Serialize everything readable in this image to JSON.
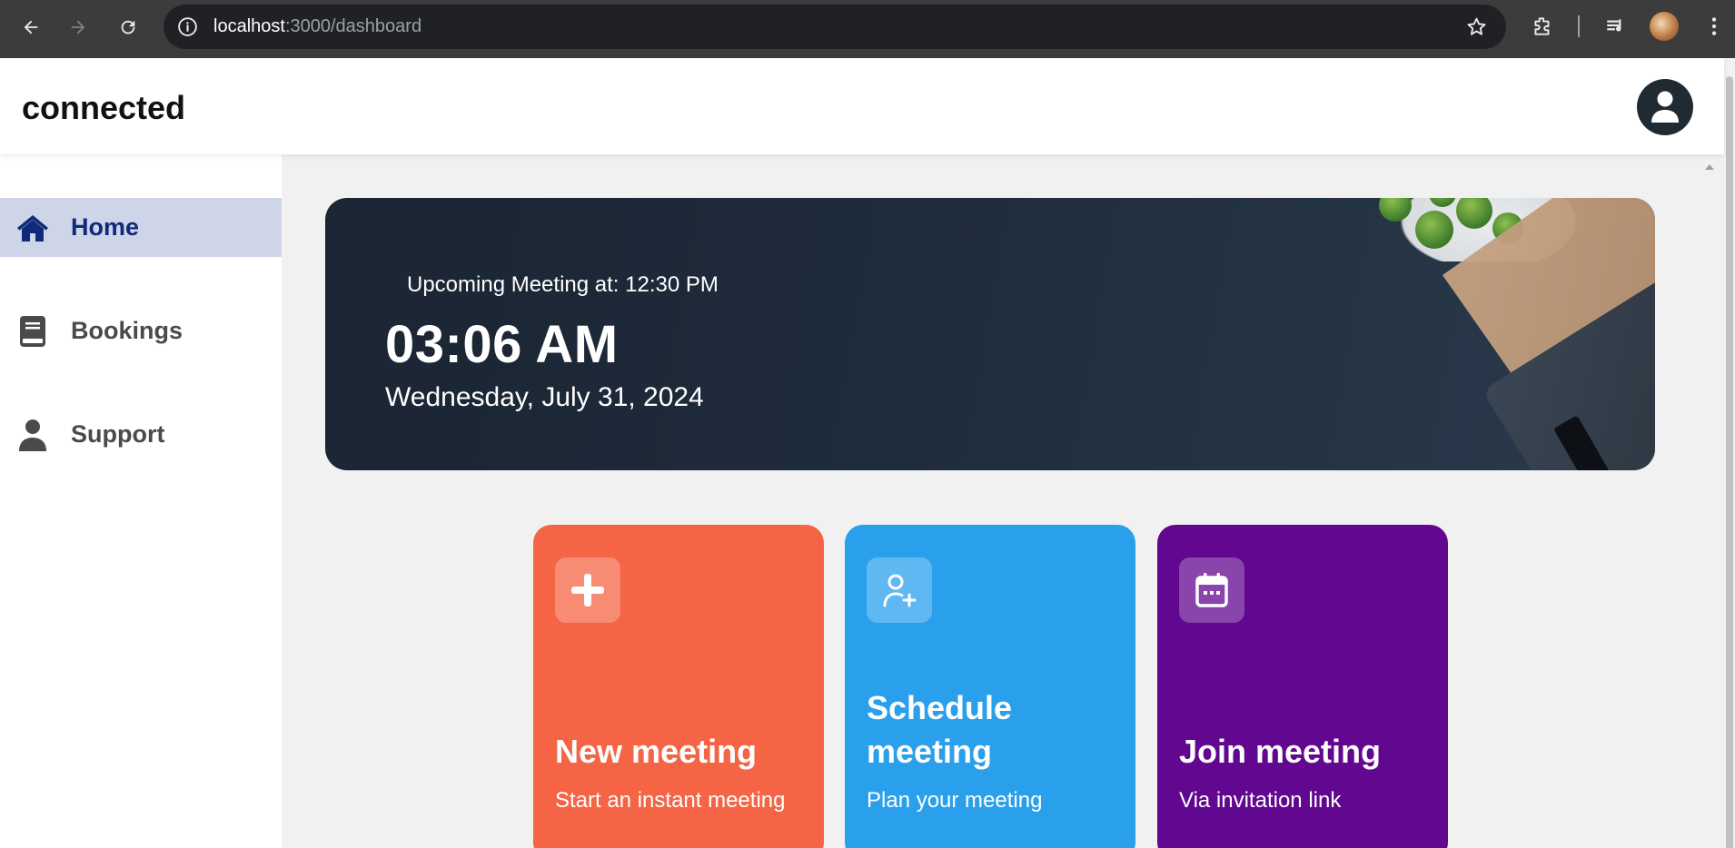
{
  "browser": {
    "url_host": "localhost",
    "url_rest": ":3000/dashboard",
    "icons": [
      "back-arrow-icon",
      "forward-arrow-icon",
      "reload-icon",
      "site-info-icon",
      "bookmark-star-icon",
      "extensions-icon",
      "media-controls-icon",
      "profile-avatar-icon",
      "more-menu-icon"
    ]
  },
  "app": {
    "brand": "connected"
  },
  "sidebar": {
    "items": [
      {
        "label": "Home",
        "icon": "home-icon",
        "active": true
      },
      {
        "label": "Bookings",
        "icon": "book-icon",
        "active": false
      },
      {
        "label": "Support",
        "icon": "user-icon",
        "active": false
      }
    ]
  },
  "hero": {
    "upcoming": "Upcoming Meeting at: 12:30 PM",
    "time": "03:06 AM",
    "date": "Wednesday, July 31, 2024"
  },
  "cards": [
    {
      "title": "New meeting",
      "subtitle": "Start an instant meeting",
      "icon": "plus-icon",
      "color": "#f46445"
    },
    {
      "title": "Schedule meeting",
      "subtitle": "Plan your meeting",
      "icon": "add-user-icon",
      "color": "#2aa0ec"
    },
    {
      "title": "Join meeting",
      "subtitle": "Via invitation link",
      "icon": "calendar-icon",
      "color": "#62078f"
    }
  ],
  "colors": {
    "active_nav_bg": "#cfd5e8",
    "active_nav_text": "#0f2a7a",
    "hero_bg": "#1b2533"
  }
}
